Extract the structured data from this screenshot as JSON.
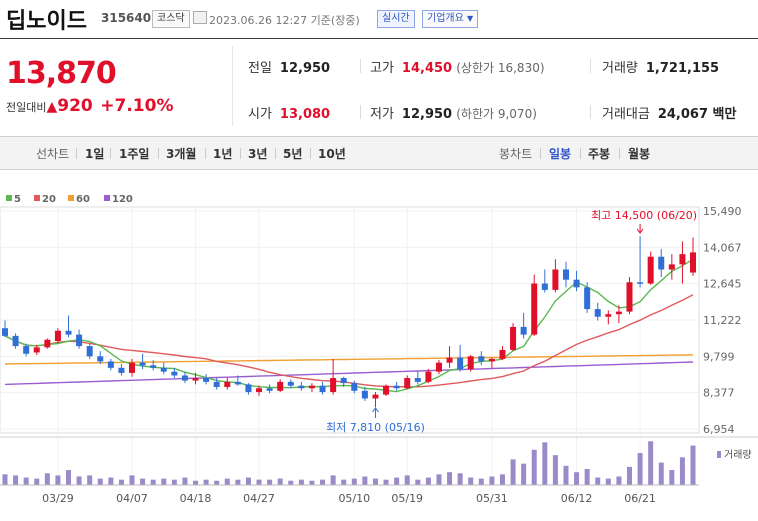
{
  "header": {
    "title": "딥노이드",
    "code": "315640",
    "market": "코스닥",
    "datetime": "2023.06.26 12:27 기준(장중)",
    "realtime_label": "실시간",
    "company_info_label": "기업개요"
  },
  "quote": {
    "price": "13,870",
    "change_label": "전일대비",
    "change": "920",
    "change_pct": "+7.10%",
    "prev_close_label": "전일",
    "prev_close": "12,950",
    "high_label": "고가",
    "high": "14,450",
    "upper_limit": "(상한가 16,830)",
    "volume_label": "거래량",
    "volume": "1,721,155",
    "open_label": "시가",
    "open": "13,080",
    "low_label": "저가",
    "low": "12,950",
    "lower_limit": "(하한가 9,070)",
    "amount_label": "거래대금",
    "amount": "24,067 백만"
  },
  "tabs": {
    "line_chart": "선차트",
    "periods": [
      "1일",
      "1주일",
      "3개월",
      "1년",
      "3년",
      "5년",
      "10년"
    ],
    "candle_chart": "봉차트",
    "intervals": [
      "일봉",
      "주봉",
      "월봉"
    ],
    "active_interval": "일봉"
  },
  "colors": {
    "up": "#e0102b",
    "down": "#2f6fd6",
    "ma5": "#5ab94f",
    "ma20": "#e05a5a",
    "ma60": "#f0a030",
    "ma120": "#9a5ed0",
    "volume": "#9a8ac8"
  },
  "chart_data": {
    "type": "candlestick",
    "legend": [
      {
        "name": "5",
        "color": "#5ab94f"
      },
      {
        "name": "20",
        "color": "#e05a5a"
      },
      {
        "name": "60",
        "color": "#f0a030"
      },
      {
        "name": "120",
        "color": "#9a5ed0"
      }
    ],
    "y_ticks": [
      "15,490",
      "14,067",
      "12,645",
      "11,222",
      "9,799",
      "8,377",
      "6,954"
    ],
    "ylim": [
      6954,
      15490
    ],
    "x_ticks": [
      "03/29",
      "04/07",
      "04/18",
      "04/27",
      "05/10",
      "05/19",
      "05/31",
      "06/12",
      "06/21"
    ],
    "volume_label": "거래량",
    "annotations": {
      "high": "최고 14,500 (06/20)",
      "low": "최저 7,810 (05/16)"
    },
    "candles": [
      [
        10900,
        11200,
        10550,
        10600
      ],
      [
        10600,
        10700,
        10100,
        10200
      ],
      [
        10200,
        10300,
        9800,
        9900
      ],
      [
        9950,
        10250,
        9850,
        10150
      ],
      [
        10150,
        10500,
        10100,
        10450
      ],
      [
        10400,
        10900,
        10300,
        10800
      ],
      [
        10800,
        11400,
        10550,
        10650
      ],
      [
        10650,
        10850,
        10100,
        10200
      ],
      [
        10200,
        10300,
        9700,
        9800
      ],
      [
        9800,
        10000,
        9500,
        9600
      ],
      [
        9600,
        9700,
        9250,
        9350
      ],
      [
        9350,
        9500,
        9050,
        9150
      ],
      [
        9150,
        9700,
        9000,
        9550
      ],
      [
        9550,
        9900,
        9300,
        9450
      ],
      [
        9450,
        9650,
        9250,
        9350
      ],
      [
        9350,
        9550,
        9100,
        9200
      ],
      [
        9200,
        9350,
        8950,
        9050
      ],
      [
        9050,
        9200,
        8750,
        8850
      ],
      [
        8850,
        9150,
        8700,
        8950
      ],
      [
        8950,
        9100,
        8700,
        8800
      ],
      [
        8800,
        8950,
        8500,
        8600
      ],
      [
        8600,
        8950,
        8500,
        8800
      ],
      [
        8800,
        9050,
        8650,
        8700
      ],
      [
        8700,
        8750,
        8300,
        8400
      ],
      [
        8400,
        8650,
        8250,
        8550
      ],
      [
        8550,
        8700,
        8350,
        8450
      ],
      [
        8450,
        8900,
        8400,
        8800
      ],
      [
        8800,
        8900,
        8550,
        8650
      ],
      [
        8650,
        8800,
        8450,
        8550
      ],
      [
        8550,
        8750,
        8400,
        8650
      ],
      [
        8650,
        8800,
        8300,
        8400
      ],
      [
        8400,
        9700,
        8300,
        8950
      ],
      [
        8950,
        9000,
        8600,
        8750
      ],
      [
        8750,
        8850,
        8350,
        8450
      ],
      [
        8450,
        8600,
        8050,
        8150
      ],
      [
        8150,
        8400,
        7810,
        8300
      ],
      [
        8300,
        8700,
        8250,
        8650
      ],
      [
        8650,
        8800,
        8450,
        8550
      ],
      [
        8550,
        9050,
        8500,
        8950
      ],
      [
        8950,
        9200,
        8700,
        8800
      ],
      [
        8800,
        9300,
        8750,
        9200
      ],
      [
        9200,
        9650,
        9100,
        9550
      ],
      [
        9550,
        10200,
        9350,
        9750
      ],
      [
        9750,
        10250,
        9200,
        9300
      ],
      [
        9300,
        9850,
        9200,
        9800
      ],
      [
        9800,
        10000,
        9450,
        9600
      ],
      [
        9600,
        9750,
        9350,
        9700
      ],
      [
        9700,
        10200,
        9650,
        10050
      ],
      [
        10050,
        11100,
        10000,
        10950
      ],
      [
        10950,
        11500,
        10500,
        10650
      ],
      [
        10650,
        13000,
        10600,
        12650
      ],
      [
        12650,
        13200,
        12300,
        12400
      ],
      [
        12400,
        13600,
        12300,
        13200
      ],
      [
        13200,
        13500,
        12500,
        12800
      ],
      [
        12800,
        13150,
        12350,
        12500
      ],
      [
        12500,
        12700,
        11500,
        11650
      ],
      [
        11650,
        11900,
        11200,
        11350
      ],
      [
        11350,
        11600,
        11050,
        11450
      ],
      [
        11450,
        11800,
        11100,
        11550
      ],
      [
        11550,
        12900,
        11450,
        12700
      ],
      [
        12700,
        14500,
        12500,
        12650
      ],
      [
        12650,
        13900,
        12600,
        13700
      ],
      [
        13700,
        14000,
        12900,
        13200
      ],
      [
        13200,
        13800,
        12800,
        13400
      ],
      [
        13400,
        14300,
        12650,
        13800
      ],
      [
        13080,
        14450,
        12950,
        13870
      ]
    ],
    "volumes": [
      10,
      9,
      7,
      6,
      11,
      9,
      14,
      8,
      9,
      6,
      7,
      5,
      9,
      6,
      5,
      6,
      5,
      7,
      4,
      5,
      4,
      6,
      5,
      7,
      5,
      5,
      6,
      4,
      5,
      4,
      5,
      9,
      5,
      6,
      8,
      6,
      5,
      7,
      9,
      5,
      7,
      10,
      12,
      11,
      7,
      6,
      8,
      10,
      24,
      20,
      33,
      40,
      28,
      18,
      12,
      15,
      7,
      6,
      8,
      17,
      30,
      41,
      21,
      14,
      26,
      37
    ]
  }
}
